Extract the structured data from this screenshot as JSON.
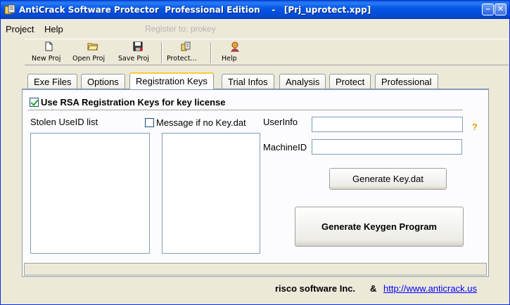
{
  "window": {
    "title": "AntiCrack Software Protector  Professional Edition    -   [Prj_uprotect.xpp]",
    "min_glyph": "–",
    "close_glyph": "✕"
  },
  "menu": {
    "items": [
      "Project",
      "Help"
    ],
    "register_text": "Register to: prokey"
  },
  "toolbar": {
    "buttons": [
      {
        "label": "New Proj",
        "icon": "new-project-icon"
      },
      {
        "label": "Open Proj",
        "icon": "open-folder-icon"
      },
      {
        "label": "Save Proj",
        "icon": "save-disk-icon"
      },
      {
        "label": "Protect...",
        "icon": "protect-icon"
      },
      {
        "label": "Help",
        "icon": "help-icon"
      }
    ]
  },
  "tabs": [
    "Exe Files",
    "Options",
    "Registration Keys",
    "Trial Infos",
    "Analysis",
    "Protect",
    "Professional"
  ],
  "active_tab": "Registration Keys",
  "panel": {
    "rsa_checkbox_label": "Use RSA Registration Keys for key license",
    "rsa_checked": true,
    "stolen_label": "Stolen UseID list",
    "message_checkbox_label": "Message if no Key.dat",
    "message_checked": false,
    "userinfo_label": "UserInfo",
    "userinfo_value": "",
    "machineid_label": "MachineID",
    "machineid_value": "",
    "help_glyph": "?",
    "generate_key_label": "Generate Key.dat",
    "generate_keygen_label": "Generate Keygen Program"
  },
  "footer": {
    "company": "risco software Inc.",
    "ampersand": "&",
    "url": "http://www.anticrack.us"
  },
  "colors": {
    "titlebar": "#0558e5",
    "face": "#ece9d8",
    "tab_highlight": "#ffc83c",
    "link": "#0000ff"
  }
}
